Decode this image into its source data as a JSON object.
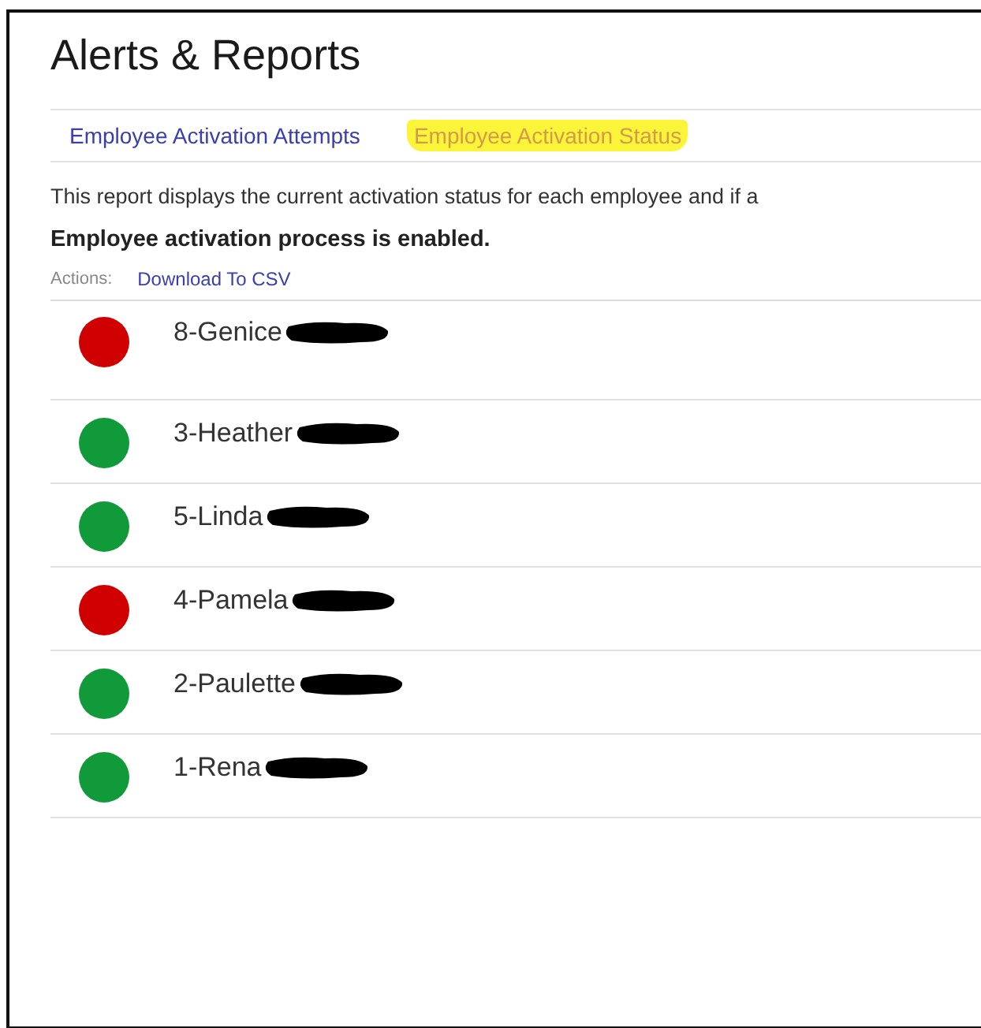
{
  "page": {
    "title": "Alerts & Reports"
  },
  "tabs": [
    {
      "label": "Employee Activation Attempts",
      "selected": false
    },
    {
      "label": "Employee Activation Status",
      "selected": true
    }
  ],
  "description": "This report displays the current activation status for each employee and if a",
  "process_status": "Employee activation process is enabled.",
  "actions": {
    "label": "Actions:",
    "links": [
      "Download To CSV"
    ]
  },
  "employees": [
    {
      "name": "8-Genice",
      "color": "#d00000",
      "redacted": true
    },
    {
      "name": "3-Heather",
      "color": "#119a3a",
      "redacted": true
    },
    {
      "name": "5-Linda",
      "color": "#119a3a",
      "redacted": true
    },
    {
      "name": "4-Pamela",
      "color": "#d00000",
      "redacted": true
    },
    {
      "name": "2-Paulette",
      "color": "#119a3a",
      "redacted": true
    },
    {
      "name": "1-Rena",
      "color": "#119a3a",
      "redacted": true
    }
  ]
}
